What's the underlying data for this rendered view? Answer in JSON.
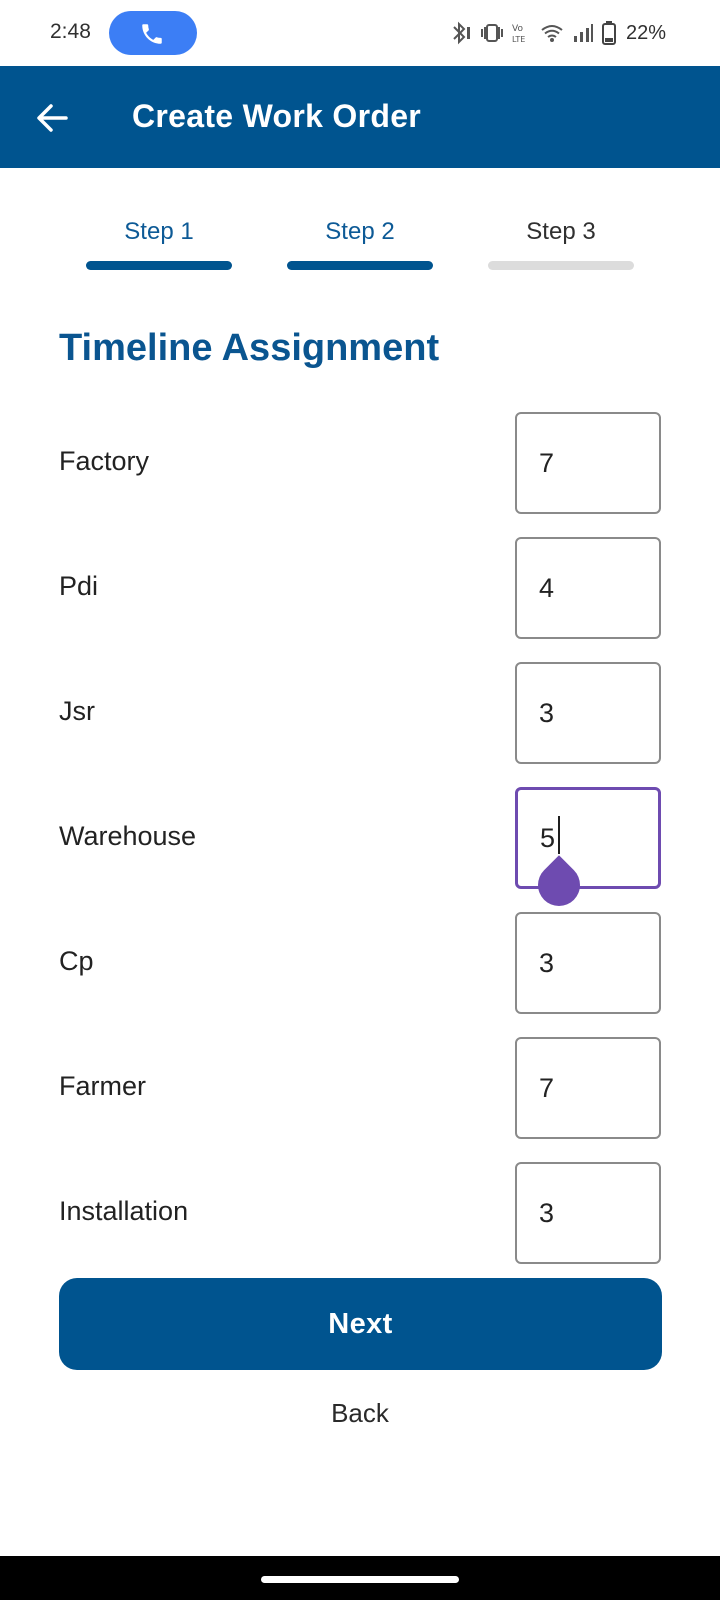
{
  "status_bar": {
    "time": "2:48",
    "battery": "22%",
    "icons": [
      "bluetooth-icon",
      "vibrate-icon",
      "volte-icon",
      "wifi-icon",
      "signal-icon",
      "battery-icon"
    ]
  },
  "app_bar": {
    "title": "Create Work Order",
    "background": "#00548f"
  },
  "stepper": {
    "steps": [
      {
        "label": "Step 1",
        "state": "complete"
      },
      {
        "label": "Step 2",
        "state": "current"
      },
      {
        "label": "Step 3",
        "state": "pending"
      }
    ]
  },
  "section_title": "Timeline Assignment",
  "timeline": [
    {
      "label": "Factory",
      "value": "7"
    },
    {
      "label": "Pdi",
      "value": "4"
    },
    {
      "label": "Jsr",
      "value": "3"
    },
    {
      "label": "Warehouse",
      "value": "5"
    },
    {
      "label": "Cp",
      "value": "3"
    },
    {
      "label": "Farmer",
      "value": "7"
    },
    {
      "label": "Installation",
      "value": "3"
    }
  ],
  "focused_field": "Warehouse",
  "actions": {
    "next_label": "Next",
    "back_label": "Back"
  },
  "colors": {
    "primary": "#00548f",
    "focus": "#6e4bb0",
    "pending_step": "#dcdcdc"
  }
}
